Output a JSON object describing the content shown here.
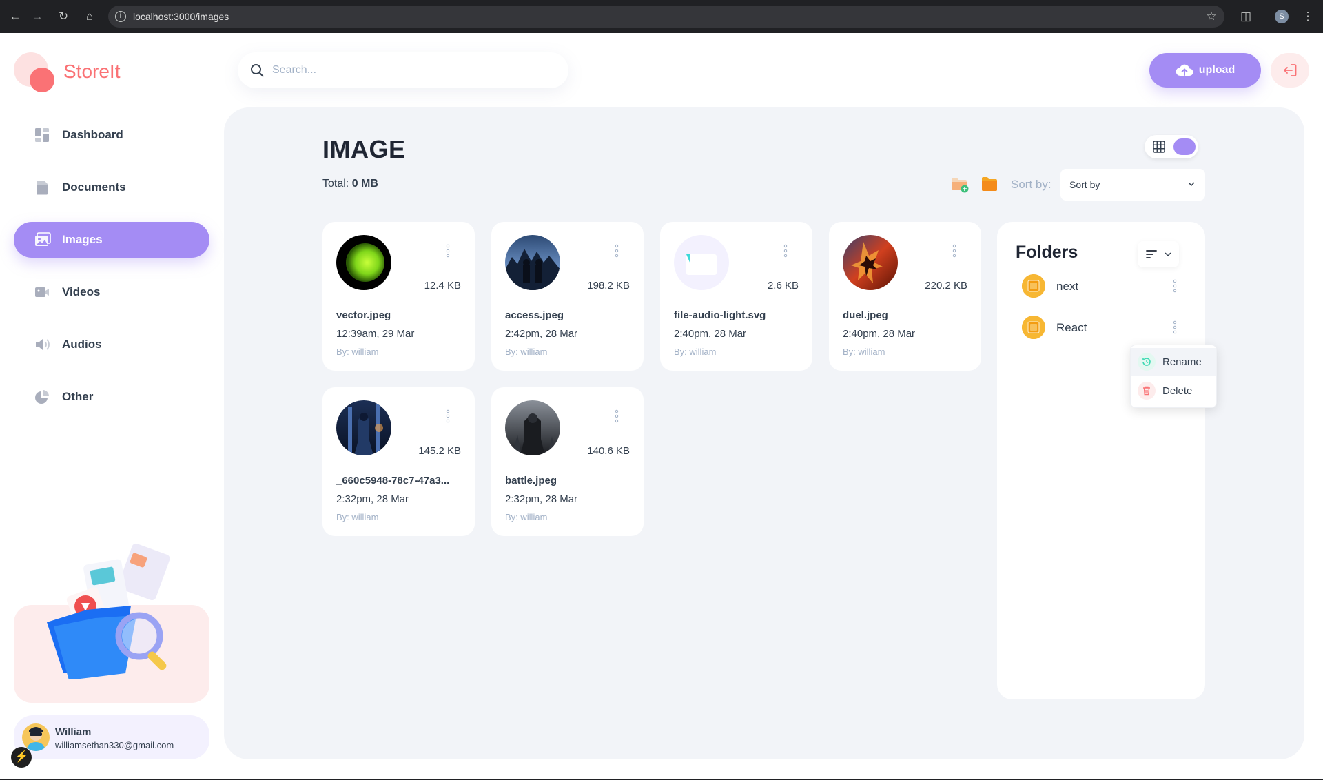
{
  "browser": {
    "url": "localhost:3000/images",
    "profile_initial": "S"
  },
  "brand": {
    "name": "StoreIt"
  },
  "sidebar": {
    "items": [
      {
        "label": "Dashboard",
        "icon": "dashboard-icon",
        "active": false
      },
      {
        "label": "Documents",
        "icon": "documents-icon",
        "active": false
      },
      {
        "label": "Images",
        "icon": "images-icon",
        "active": true
      },
      {
        "label": "Videos",
        "icon": "video-icon",
        "active": false
      },
      {
        "label": "Audios",
        "icon": "audio-icon",
        "active": false
      },
      {
        "label": "Other",
        "icon": "pie-chart-icon",
        "active": false
      }
    ]
  },
  "user": {
    "name": "William",
    "email": "williamsethan330@gmail.com"
  },
  "header": {
    "search_placeholder": "Search...",
    "upload_label": "upload"
  },
  "page": {
    "title": "IMAGE",
    "total_label": "Total:",
    "total_value": "0 MB",
    "sort_label": "Sort by:",
    "sort_value": "Sort by"
  },
  "files": [
    {
      "name": "vector.jpeg",
      "size": "12.4 KB",
      "date": "12:39am, 29 Mar",
      "by": "By: william",
      "thumb": "green-orb"
    },
    {
      "name": "access.jpeg",
      "size": "198.2 KB",
      "date": "2:42pm, 28 Mar",
      "by": "By: william",
      "thumb": "city-night"
    },
    {
      "name": "file-audio-light.svg",
      "size": "2.6 KB",
      "date": "2:40pm, 28 Mar",
      "by": "By: william",
      "thumb": "svg-file"
    },
    {
      "name": "duel.jpeg",
      "size": "220.2 KB",
      "date": "2:40pm, 28 Mar",
      "by": "By: william",
      "thumb": "fire-battle"
    },
    {
      "name": "_660c5948-78c7-47a3...",
      "size": "145.2 KB",
      "date": "2:32pm, 28 Mar",
      "by": "By: william",
      "thumb": "blue-knight"
    },
    {
      "name": "battle.jpeg",
      "size": "140.6 KB",
      "date": "2:32pm, 28 Mar",
      "by": "By: william",
      "thumb": "dark-warrior"
    }
  ],
  "folders": {
    "title": "Folders",
    "items": [
      {
        "name": "next"
      },
      {
        "name": "React"
      }
    ],
    "context_menu": [
      {
        "label": "Rename",
        "icon": "rename-icon",
        "color": "#3dd9b3"
      },
      {
        "label": "Delete",
        "icon": "trash-icon",
        "color": "#fa7275"
      }
    ]
  },
  "colors": {
    "brand": "#fa7275",
    "accent": "#a48cf4",
    "folder": "#f5a623"
  }
}
